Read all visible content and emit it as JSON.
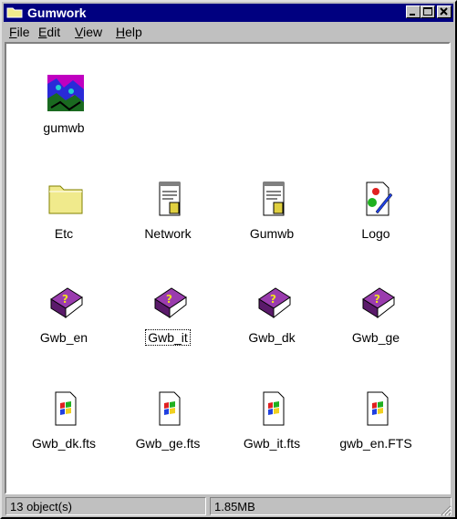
{
  "window": {
    "title": "Gumwork"
  },
  "menu": {
    "file": "File",
    "edit": "Edit",
    "view": "View",
    "help": "Help"
  },
  "items": [
    {
      "label": "gumwb",
      "icon": "image-thumbnail-icon"
    },
    {
      "label": "Etc",
      "icon": "folder-icon"
    },
    {
      "label": "Network",
      "icon": "notepad-document-icon"
    },
    {
      "label": "Gumwb",
      "icon": "notepad-document-icon"
    },
    {
      "label": "Logo",
      "icon": "paint-document-icon"
    },
    {
      "label": "Gwb_en",
      "icon": "help-book-icon"
    },
    {
      "label": "Gwb_it",
      "icon": "help-book-icon"
    },
    {
      "label": "Gwb_dk",
      "icon": "help-book-icon"
    },
    {
      "label": "Gwb_ge",
      "icon": "help-book-icon"
    },
    {
      "label": "Gwb_dk.fts",
      "icon": "windows-file-icon"
    },
    {
      "label": "Gwb_ge.fts",
      "icon": "windows-file-icon"
    },
    {
      "label": "Gwb_it.fts",
      "icon": "windows-file-icon"
    },
    {
      "label": "gwb_en.FTS",
      "icon": "windows-file-icon"
    }
  ],
  "status": {
    "objects": "13 object(s)",
    "size": "1.85MB"
  },
  "colors": {
    "titlebar": "#000080",
    "face": "#c0c0c0",
    "book": "#7b2f8a",
    "folder": "#f0ea8c"
  }
}
